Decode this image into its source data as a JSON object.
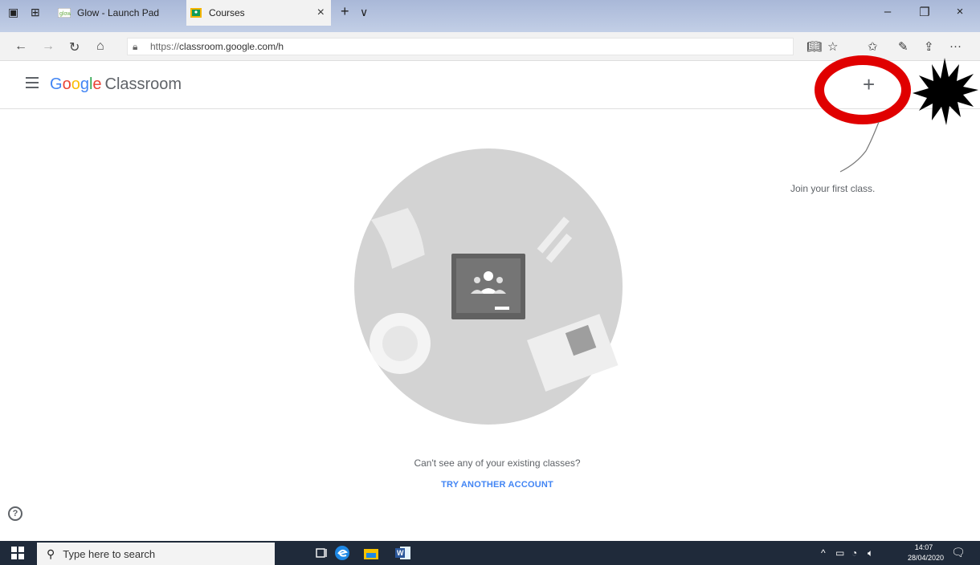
{
  "browser": {
    "tabs": [
      {
        "label": "Glow - Launch Pad",
        "favicon": "glow-favicon"
      },
      {
        "label": "Courses",
        "favicon": "classroom-favicon",
        "close": "×"
      }
    ],
    "new_tab": "+",
    "tab_list": "∨",
    "window_controls": {
      "minimize": "–",
      "restore": "❐",
      "close": "×"
    },
    "url_scheme": "https://",
    "url_rest": "classroom.google.com/h",
    "toolbar_more": "···"
  },
  "app": {
    "brand_letters": [
      "G",
      "o",
      "o",
      "g",
      "l",
      "e"
    ],
    "product": "Classroom",
    "add_button": "+",
    "hint_text": "Join your first class.",
    "cant_see": "Can't see any of your existing classes?",
    "try_another": "TRY ANOTHER ACCOUNT",
    "help": "?"
  },
  "taskbar": {
    "search_placeholder": "Type here to search",
    "time": "14:07",
    "date": "28/04/2020"
  },
  "colors": {
    "brand_blue": "#4285F4",
    "brand_red": "#EA4335",
    "brand_yellow": "#FBBC05",
    "brand_green": "#34A853",
    "annotation_red": "#e00000",
    "link_blue": "#4285f4"
  }
}
